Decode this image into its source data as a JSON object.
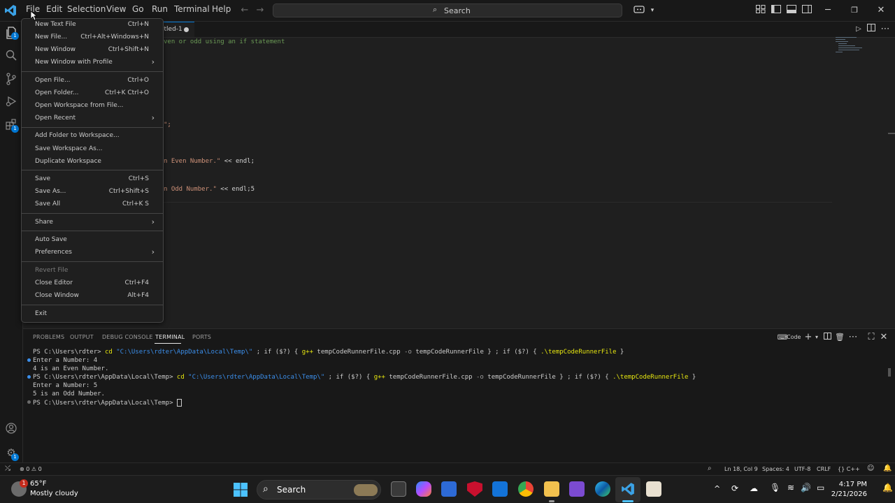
{
  "menubar": [
    "File",
    "Edit",
    "Selection",
    "View",
    "Go",
    "Run",
    "Terminal",
    "Help"
  ],
  "search": {
    "label": "Search"
  },
  "activity_badges": {
    "explorer": "1",
    "extensions": "1"
  },
  "tab": {
    "label": "itled-1"
  },
  "code_lines": [
    {
      "text": "ven or odd using an if statement",
      "cls": "comment"
    },
    {
      "text": "\";",
      "cls": "str"
    },
    {
      "text_str": "n Even Number.\"",
      "text_rest": " << endl;"
    },
    {
      "text_str": "n Odd Number.\"",
      "text_rest": " << endl;5"
    }
  ],
  "file_menu": {
    "items": [
      {
        "label": "New Text File",
        "shortcut": "Ctrl+N"
      },
      {
        "label": "New File...",
        "shortcut": "Ctrl+Alt+Windows+N"
      },
      {
        "label": "New Window",
        "shortcut": "Ctrl+Shift+N"
      },
      {
        "label": "New Window with Profile",
        "submenu": true
      },
      {
        "label": "Open File...",
        "shortcut": "Ctrl+O"
      },
      {
        "label": "Open Folder...",
        "shortcut": "Ctrl+K Ctrl+O"
      },
      {
        "label": "Open Workspace from File..."
      },
      {
        "label": "Open Recent",
        "submenu": true
      },
      {
        "label": "Add Folder to Workspace..."
      },
      {
        "label": "Save Workspace As..."
      },
      {
        "label": "Duplicate Workspace"
      },
      {
        "label": "Save",
        "shortcut": "Ctrl+S"
      },
      {
        "label": "Save As...",
        "shortcut": "Ctrl+Shift+S"
      },
      {
        "label": "Save All",
        "shortcut": "Ctrl+K S"
      },
      {
        "label": "Share",
        "submenu": true
      },
      {
        "label": "Auto Save"
      },
      {
        "label": "Preferences",
        "submenu": true
      },
      {
        "label": "Revert File",
        "disabled": true
      },
      {
        "label": "Close Editor",
        "shortcut": "Ctrl+F4"
      },
      {
        "label": "Close Window",
        "shortcut": "Alt+F4"
      },
      {
        "label": "Exit"
      }
    ]
  },
  "panel": {
    "tabs": [
      "PROBLEMS",
      "OUTPUT",
      "DEBUG CONSOLE",
      "TERMINAL",
      "PORTS"
    ],
    "active_tab": "TERMINAL",
    "terminal_profile": "Code"
  },
  "terminal": {
    "cmd_prompt_1": "PS C:\\Users\\rdter> ",
    "cmd_prompt_2": "PS C:\\Users\\rdter\\AppData\\Local\\Temp> ",
    "cmd_prompt_3": "PS C:\\Users\\rdter\\AppData\\Local\\Temp> ",
    "cd": "cd",
    "path": "\"C:\\Users\\rdter\\AppData\\Local\\Temp\\\"",
    "semi_if": " ; if ($?) { ",
    "gpp": "g++",
    "file": " tempCodeRunnerFile.cpp ",
    "flag": "-o",
    "out": " tempCodeRunnerFile } ; if ($?) { ",
    "exe": ".\\tempCodeRunnerFile",
    "close": " }",
    "lines": [
      "Enter a Number: 4",
      "4 is an Even Number.",
      "Enter a Number: 5",
      "5 is an Odd Number."
    ]
  },
  "statusbar": {
    "errors": "0",
    "warnings": "0",
    "position": "Ln 18, Col 9",
    "spaces": "Spaces: 4",
    "encoding": "UTF-8",
    "eol": "CRLF",
    "language": "C++"
  },
  "taskbar": {
    "weather_temp": "65°F",
    "weather_desc": "Mostly cloudy",
    "weather_badge": "1",
    "search_label": "Search",
    "time": "4:17 PM",
    "date": "2/21/2026"
  },
  "colors": {
    "accent": "#0078d4",
    "comment": "#6a9955",
    "string": "#ce9178"
  }
}
